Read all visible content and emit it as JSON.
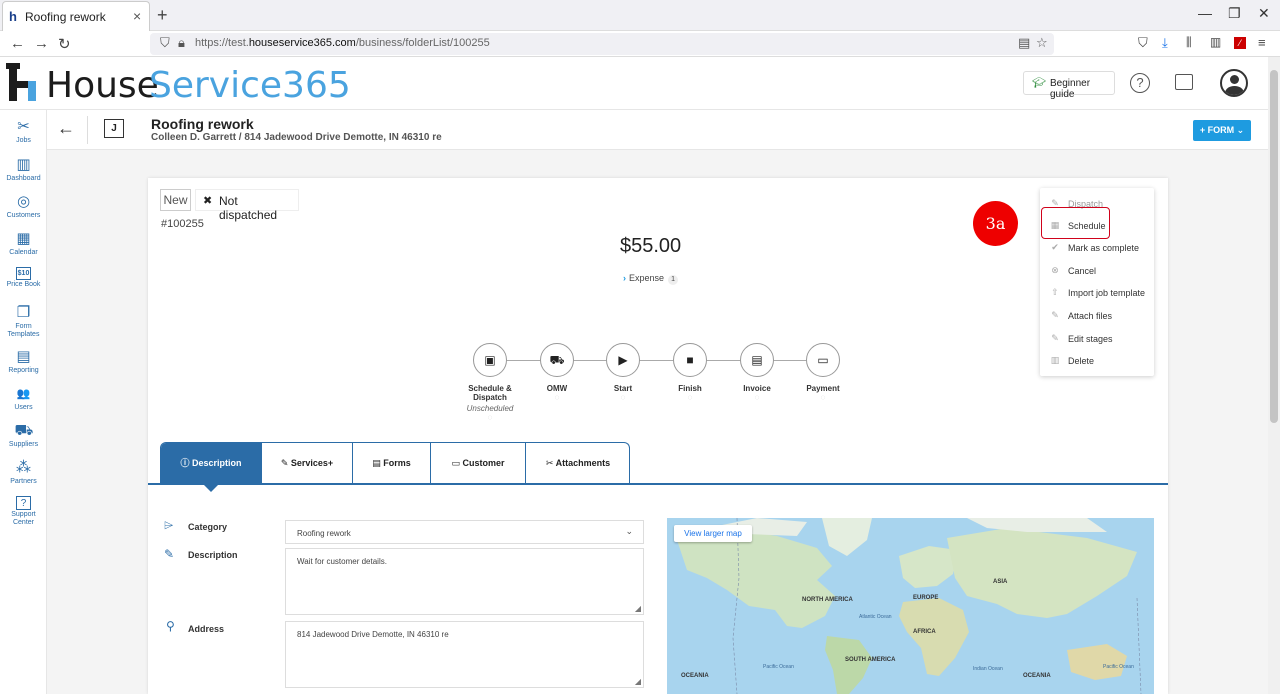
{
  "browser": {
    "tab_title": "Roofing rework",
    "tab_close": "×",
    "new_tab": "+",
    "url_prefix": "https://test.",
    "url_domain": "houseservice365.com",
    "url_path": "/business/folderList/100255"
  },
  "header": {
    "logo_part1": "House",
    "logo_part2": "Service365",
    "beginner_guide": "Beginner guide",
    "help": "?"
  },
  "sidebar": {
    "items": [
      {
        "label": "Jobs",
        "icon": "✂"
      },
      {
        "label": "Dashboard",
        "icon": "▥"
      },
      {
        "label": "Customers",
        "icon": "◎"
      },
      {
        "label": "Calendar",
        "icon": "▦"
      },
      {
        "label": "Price Book",
        "icon": "$10"
      },
      {
        "label": "Form Templates",
        "icon": "❐"
      },
      {
        "label": "Reporting",
        "icon": "▤"
      },
      {
        "label": "Users",
        "icon": "👥"
      },
      {
        "label": "Suppliers",
        "icon": "⛟"
      },
      {
        "label": "Partners",
        "icon": "⁂"
      },
      {
        "label": "Support Center",
        "icon": "?"
      }
    ]
  },
  "job": {
    "badge": "J",
    "title": "Roofing rework",
    "subtitle": "Colleen D. Garrett / 814 Jadewood Drive Demotte, IN 46310 re",
    "form_button": "+ FORM ⌄",
    "status_new": "New",
    "status_dispatch": "Not dispatched",
    "number": "#100255",
    "amount": "$55.00",
    "expense_label": "Expense",
    "expense_count": "1"
  },
  "stages": [
    {
      "label": "Schedule & Dispatch",
      "sub": "Unscheduled",
      "icon": "▣"
    },
    {
      "label": "OMW",
      "sub": "",
      "icon": "⛟"
    },
    {
      "label": "Start",
      "sub": "",
      "icon": "▶"
    },
    {
      "label": "Finish",
      "sub": "",
      "icon": "■"
    },
    {
      "label": "Invoice",
      "sub": "",
      "icon": "▤"
    },
    {
      "label": "Payment",
      "sub": "",
      "icon": "▭"
    }
  ],
  "tabs": [
    {
      "label": "Description",
      "icon": "ⓘ"
    },
    {
      "label": "Services+",
      "icon": "✎"
    },
    {
      "label": "Forms",
      "icon": "▤"
    },
    {
      "label": "Customer",
      "icon": "▭"
    },
    {
      "label": "Attachments",
      "icon": "✂"
    }
  ],
  "fields": {
    "category_label": "Category",
    "category_value": "Roofing rework",
    "description_label": "Description",
    "description_value": "Wait for customer details.",
    "address_label": "Address",
    "address_value": "814 Jadewood Drive Demotte, IN 46310 re"
  },
  "map": {
    "view_larger": "View larger map",
    "labels": [
      "NORTH AMERICA",
      "EUROPE",
      "ASIA",
      "AFRICA",
      "SOUTH AMERICA",
      "OCEANIA",
      "OCEANIA"
    ],
    "oceans": [
      "Atlantic Ocean",
      "Pacific Ocean",
      "Pacific Ocean",
      "Indian Ocean"
    ]
  },
  "menu": {
    "items": [
      {
        "label": "Dispatch",
        "icon": "✎"
      },
      {
        "label": "Schedule",
        "icon": "▦"
      },
      {
        "label": "Mark as complete",
        "icon": "✔"
      },
      {
        "label": "Cancel",
        "icon": "⊗"
      },
      {
        "label": "Import job template",
        "icon": "⇧"
      },
      {
        "label": "Attach files",
        "icon": "✎"
      },
      {
        "label": "Edit stages",
        "icon": "✎"
      },
      {
        "label": "Delete",
        "icon": "▥"
      }
    ]
  },
  "annotation": {
    "step": "3a"
  },
  "colors": {
    "primary": "#2b6ca7",
    "accent": "#1e9be0",
    "annotation": "#ee0000"
  }
}
